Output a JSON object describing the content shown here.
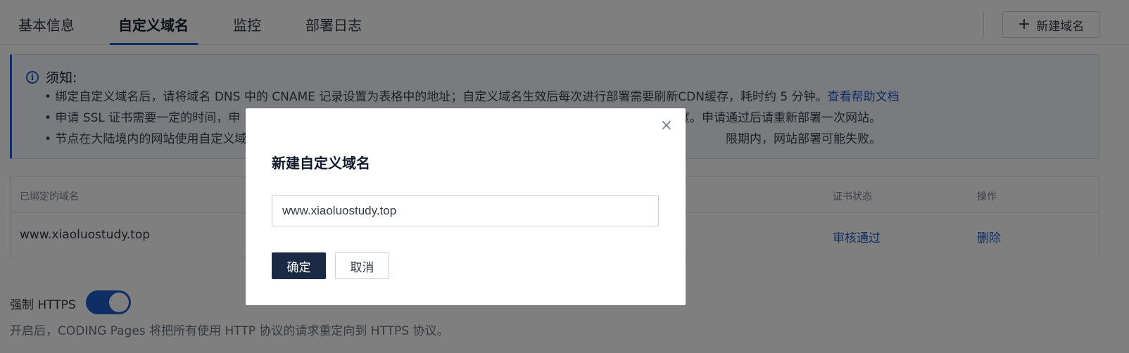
{
  "tabs": [
    {
      "label": "基本信息"
    },
    {
      "label": "自定义域名",
      "active": true
    },
    {
      "label": "监控"
    },
    {
      "label": "部署日志"
    }
  ],
  "header": {
    "new_domain_label": "新建域名"
  },
  "notice": {
    "title": "须知:",
    "line1": "• 绑定自定义域名后，请将域名 DNS 中的 CNAME 记录设置为表格中的地址；自定义域名生效后每次进行部署需要刷新CDN缓存，耗时约 5 分钟。",
    "line1_link": "查看帮助文档",
    "line2_start": "• 申请 SSL 证书需要一定的时间，申",
    "line2_end": "请进度。申请通过后请重新部署一次网站。",
    "line3_start": "• 节点在大陆境内的网站使用自定义域",
    "line3_end": "限期内，网站部署可能失败。"
  },
  "table": {
    "headers": {
      "domain": "已绑定的域名",
      "cert_status": "证书状态",
      "action": "操作"
    },
    "rows": [
      {
        "domain": "www.xiaoluostudy.top",
        "cert_status": "审核通过",
        "action": "删除"
      }
    ]
  },
  "https": {
    "label": "强制 HTTPS",
    "enabled": true,
    "description": "开启后，CODING Pages 将把所有使用 HTTP 协议的请求重定向到 HTTPS 协议。"
  },
  "modal": {
    "title": "新建自定义域名",
    "input_value": "www.xiaoluostudy.top",
    "ok_label": "确定",
    "cancel_label": "取消",
    "close_symbol": "×"
  },
  "colors": {
    "accent": "#1f5ccc",
    "primary_button": "#1b2a44",
    "overlay": "rgba(0,0,0,0.5)"
  }
}
